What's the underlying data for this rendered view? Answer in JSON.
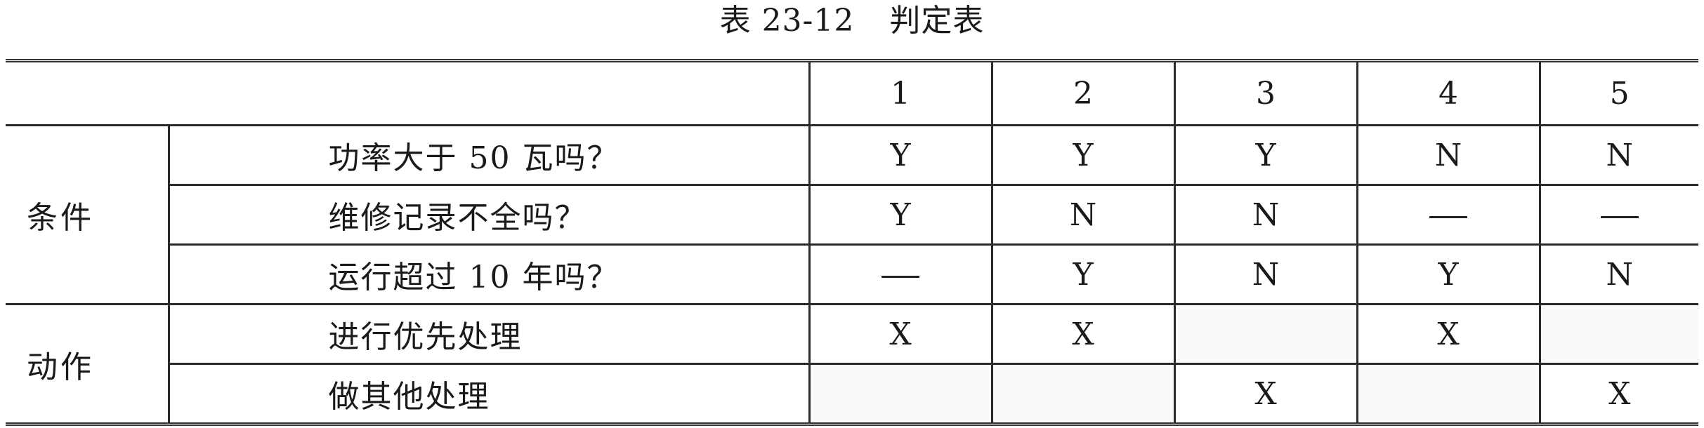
{
  "caption": {
    "number": "表 23-12",
    "title": "判定表"
  },
  "columns": [
    "1",
    "2",
    "3",
    "4",
    "5"
  ],
  "condition_group": {
    "label": "条件",
    "rows": [
      {
        "label": "功率大于 50 瓦吗？",
        "cells": [
          "Y",
          "Y",
          "Y",
          "N",
          "N"
        ]
      },
      {
        "label": "维修记录不全吗？",
        "cells": [
          "Y",
          "N",
          "N",
          "—",
          "—"
        ]
      },
      {
        "label": "运行超过 10 年吗？",
        "cells": [
          "—",
          "Y",
          "N",
          "Y",
          "N"
        ]
      }
    ]
  },
  "action_group": {
    "label": "动作",
    "rows": [
      {
        "label": "进行优先处理",
        "cells": [
          "X",
          "X",
          "",
          "X",
          ""
        ]
      },
      {
        "label": "做其他处理",
        "cells": [
          "",
          "",
          "X",
          "",
          "X"
        ]
      }
    ]
  }
}
